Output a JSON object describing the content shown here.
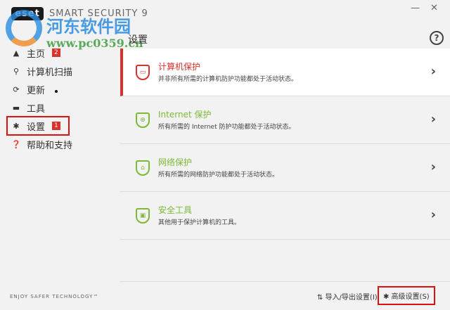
{
  "titlebar": {
    "logo": "eset",
    "product": "SMART SECURITY 9",
    "minimize": "—",
    "close": "✕"
  },
  "watermark": {
    "name": "河东软件园",
    "url": "www.pc0359.cn"
  },
  "sidebar": {
    "items": [
      {
        "label": "主页",
        "icon": "warning-icon",
        "glyph": "▲",
        "badge": "2"
      },
      {
        "label": "计算机扫描",
        "icon": "search-icon",
        "glyph": "🔍"
      },
      {
        "label": "更新",
        "icon": "refresh-icon",
        "glyph": "⟳"
      },
      {
        "label": "工具",
        "icon": "toolbox-icon",
        "glyph": "▬"
      },
      {
        "label": "设置",
        "icon": "gear-icon",
        "glyph": "✱",
        "badge": "1"
      },
      {
        "label": "帮助和支持",
        "icon": "help-icon",
        "glyph": "❓"
      }
    ],
    "tagline": "ENJOY SAFER TECHNOLOGY™"
  },
  "page": {
    "title": "设置",
    "help": "?"
  },
  "cards": [
    {
      "title": "计算机保护",
      "desc": "并非所有所需的计算机防护功能都处于活动状态。",
      "glyph": "▭"
    },
    {
      "title": "Internet 保护",
      "desc": "所有所需的 Internet 防护功能都处于活动状态。",
      "glyph": "⊕"
    },
    {
      "title": "网络保护",
      "desc": "所有所需的网络防护功能都处于活动状态。",
      "glyph": "⌂"
    },
    {
      "title": "安全工具",
      "desc": "其他用于保护计算机的工具。",
      "glyph": "▣"
    }
  ],
  "footer": {
    "import_export": "⇅ 导入/导出设置(I)",
    "advanced": "✱ 高级设置(S)"
  },
  "colors": {
    "alert": "#d9312c",
    "ok": "#7cb937"
  }
}
